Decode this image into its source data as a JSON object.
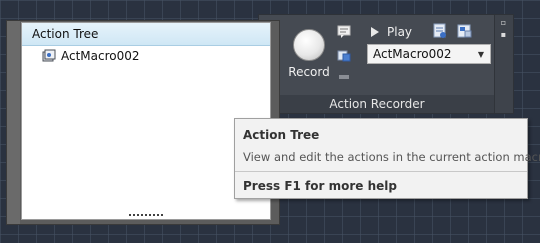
{
  "action_tree": {
    "header": "Action Tree",
    "items": [
      {
        "label": "ActMacro002",
        "icon": "macro-icon"
      }
    ]
  },
  "ribbon": {
    "record_label": "Record",
    "play_label": "Play",
    "macro_select_value": "ActMacro002",
    "panel_title": "Action Recorder"
  },
  "tooltip": {
    "title": "Action Tree",
    "description": "View and edit the actions in the current action macro",
    "help": "Press F1 for more help"
  },
  "colors": {
    "ribbon_bg": "#454a52",
    "canvas_bg": "#2a3240",
    "tree_header": "#d6ecf7",
    "tooltip_bg": "#f2f2f2"
  }
}
